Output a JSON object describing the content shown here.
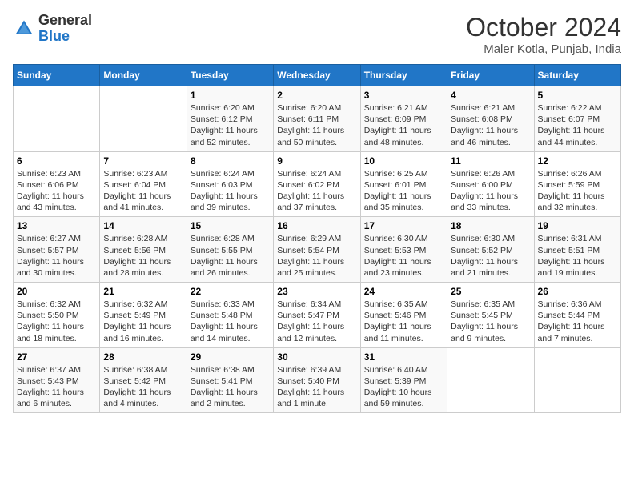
{
  "header": {
    "logo_general": "General",
    "logo_blue": "Blue",
    "month_title": "October 2024",
    "location": "Maler Kotla, Punjab, India"
  },
  "days_of_week": [
    "Sunday",
    "Monday",
    "Tuesday",
    "Wednesday",
    "Thursday",
    "Friday",
    "Saturday"
  ],
  "weeks": [
    [
      {
        "day": "",
        "sunrise": "",
        "sunset": "",
        "daylight": ""
      },
      {
        "day": "",
        "sunrise": "",
        "sunset": "",
        "daylight": ""
      },
      {
        "day": "1",
        "sunrise": "Sunrise: 6:20 AM",
        "sunset": "Sunset: 6:12 PM",
        "daylight": "Daylight: 11 hours and 52 minutes."
      },
      {
        "day": "2",
        "sunrise": "Sunrise: 6:20 AM",
        "sunset": "Sunset: 6:11 PM",
        "daylight": "Daylight: 11 hours and 50 minutes."
      },
      {
        "day": "3",
        "sunrise": "Sunrise: 6:21 AM",
        "sunset": "Sunset: 6:09 PM",
        "daylight": "Daylight: 11 hours and 48 minutes."
      },
      {
        "day": "4",
        "sunrise": "Sunrise: 6:21 AM",
        "sunset": "Sunset: 6:08 PM",
        "daylight": "Daylight: 11 hours and 46 minutes."
      },
      {
        "day": "5",
        "sunrise": "Sunrise: 6:22 AM",
        "sunset": "Sunset: 6:07 PM",
        "daylight": "Daylight: 11 hours and 44 minutes."
      }
    ],
    [
      {
        "day": "6",
        "sunrise": "Sunrise: 6:23 AM",
        "sunset": "Sunset: 6:06 PM",
        "daylight": "Daylight: 11 hours and 43 minutes."
      },
      {
        "day": "7",
        "sunrise": "Sunrise: 6:23 AM",
        "sunset": "Sunset: 6:04 PM",
        "daylight": "Daylight: 11 hours and 41 minutes."
      },
      {
        "day": "8",
        "sunrise": "Sunrise: 6:24 AM",
        "sunset": "Sunset: 6:03 PM",
        "daylight": "Daylight: 11 hours and 39 minutes."
      },
      {
        "day": "9",
        "sunrise": "Sunrise: 6:24 AM",
        "sunset": "Sunset: 6:02 PM",
        "daylight": "Daylight: 11 hours and 37 minutes."
      },
      {
        "day": "10",
        "sunrise": "Sunrise: 6:25 AM",
        "sunset": "Sunset: 6:01 PM",
        "daylight": "Daylight: 11 hours and 35 minutes."
      },
      {
        "day": "11",
        "sunrise": "Sunrise: 6:26 AM",
        "sunset": "Sunset: 6:00 PM",
        "daylight": "Daylight: 11 hours and 33 minutes."
      },
      {
        "day": "12",
        "sunrise": "Sunrise: 6:26 AM",
        "sunset": "Sunset: 5:59 PM",
        "daylight": "Daylight: 11 hours and 32 minutes."
      }
    ],
    [
      {
        "day": "13",
        "sunrise": "Sunrise: 6:27 AM",
        "sunset": "Sunset: 5:57 PM",
        "daylight": "Daylight: 11 hours and 30 minutes."
      },
      {
        "day": "14",
        "sunrise": "Sunrise: 6:28 AM",
        "sunset": "Sunset: 5:56 PM",
        "daylight": "Daylight: 11 hours and 28 minutes."
      },
      {
        "day": "15",
        "sunrise": "Sunrise: 6:28 AM",
        "sunset": "Sunset: 5:55 PM",
        "daylight": "Daylight: 11 hours and 26 minutes."
      },
      {
        "day": "16",
        "sunrise": "Sunrise: 6:29 AM",
        "sunset": "Sunset: 5:54 PM",
        "daylight": "Daylight: 11 hours and 25 minutes."
      },
      {
        "day": "17",
        "sunrise": "Sunrise: 6:30 AM",
        "sunset": "Sunset: 5:53 PM",
        "daylight": "Daylight: 11 hours and 23 minutes."
      },
      {
        "day": "18",
        "sunrise": "Sunrise: 6:30 AM",
        "sunset": "Sunset: 5:52 PM",
        "daylight": "Daylight: 11 hours and 21 minutes."
      },
      {
        "day": "19",
        "sunrise": "Sunrise: 6:31 AM",
        "sunset": "Sunset: 5:51 PM",
        "daylight": "Daylight: 11 hours and 19 minutes."
      }
    ],
    [
      {
        "day": "20",
        "sunrise": "Sunrise: 6:32 AM",
        "sunset": "Sunset: 5:50 PM",
        "daylight": "Daylight: 11 hours and 18 minutes."
      },
      {
        "day": "21",
        "sunrise": "Sunrise: 6:32 AM",
        "sunset": "Sunset: 5:49 PM",
        "daylight": "Daylight: 11 hours and 16 minutes."
      },
      {
        "day": "22",
        "sunrise": "Sunrise: 6:33 AM",
        "sunset": "Sunset: 5:48 PM",
        "daylight": "Daylight: 11 hours and 14 minutes."
      },
      {
        "day": "23",
        "sunrise": "Sunrise: 6:34 AM",
        "sunset": "Sunset: 5:47 PM",
        "daylight": "Daylight: 11 hours and 12 minutes."
      },
      {
        "day": "24",
        "sunrise": "Sunrise: 6:35 AM",
        "sunset": "Sunset: 5:46 PM",
        "daylight": "Daylight: 11 hours and 11 minutes."
      },
      {
        "day": "25",
        "sunrise": "Sunrise: 6:35 AM",
        "sunset": "Sunset: 5:45 PM",
        "daylight": "Daylight: 11 hours and 9 minutes."
      },
      {
        "day": "26",
        "sunrise": "Sunrise: 6:36 AM",
        "sunset": "Sunset: 5:44 PM",
        "daylight": "Daylight: 11 hours and 7 minutes."
      }
    ],
    [
      {
        "day": "27",
        "sunrise": "Sunrise: 6:37 AM",
        "sunset": "Sunset: 5:43 PM",
        "daylight": "Daylight: 11 hours and 6 minutes."
      },
      {
        "day": "28",
        "sunrise": "Sunrise: 6:38 AM",
        "sunset": "Sunset: 5:42 PM",
        "daylight": "Daylight: 11 hours and 4 minutes."
      },
      {
        "day": "29",
        "sunrise": "Sunrise: 6:38 AM",
        "sunset": "Sunset: 5:41 PM",
        "daylight": "Daylight: 11 hours and 2 minutes."
      },
      {
        "day": "30",
        "sunrise": "Sunrise: 6:39 AM",
        "sunset": "Sunset: 5:40 PM",
        "daylight": "Daylight: 11 hours and 1 minute."
      },
      {
        "day": "31",
        "sunrise": "Sunrise: 6:40 AM",
        "sunset": "Sunset: 5:39 PM",
        "daylight": "Daylight: 10 hours and 59 minutes."
      },
      {
        "day": "",
        "sunrise": "",
        "sunset": "",
        "daylight": ""
      },
      {
        "day": "",
        "sunrise": "",
        "sunset": "",
        "daylight": ""
      }
    ]
  ]
}
